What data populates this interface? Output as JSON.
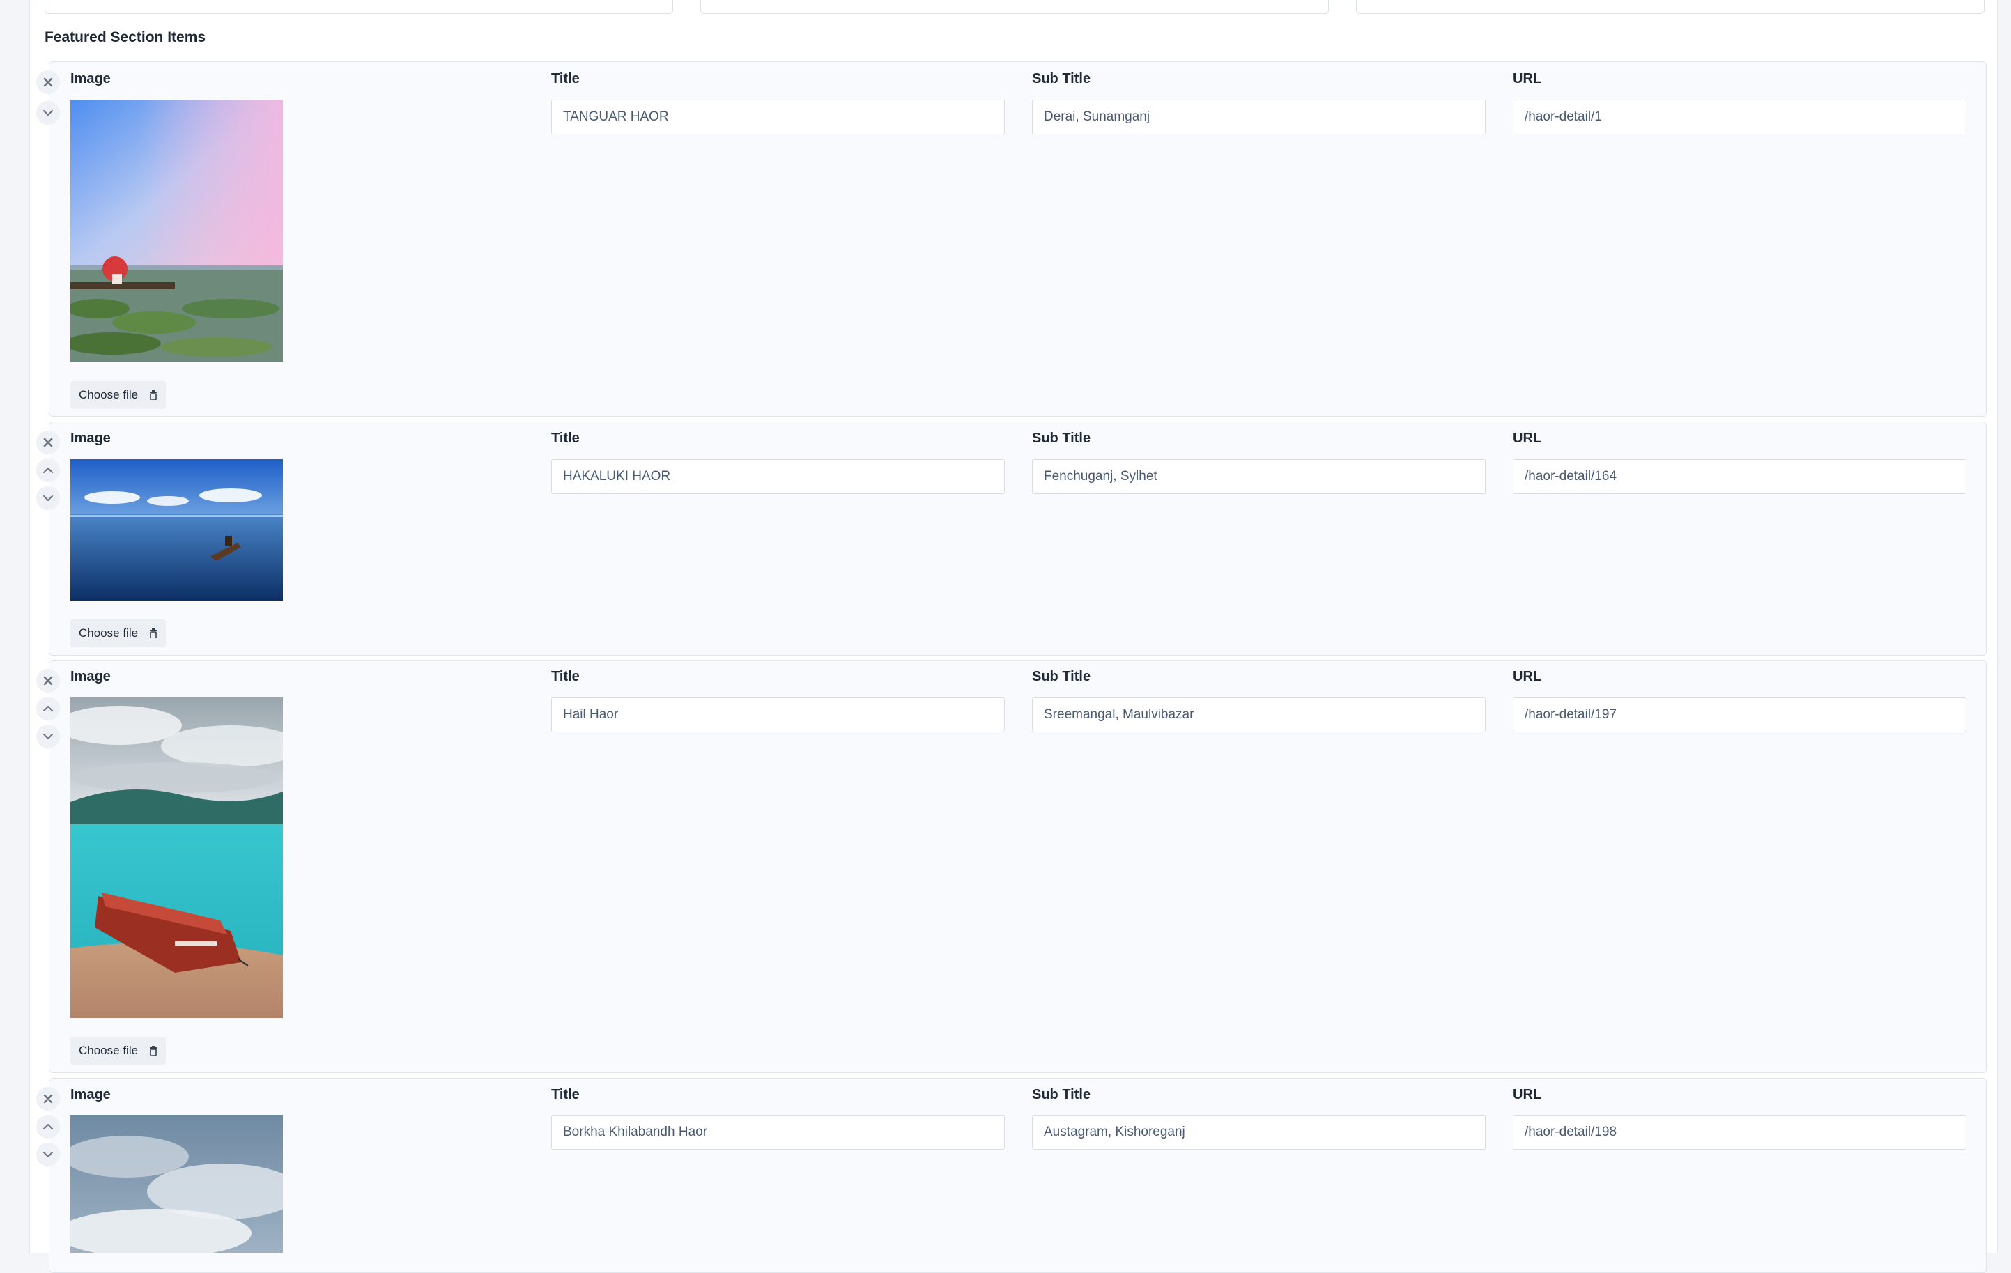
{
  "section_title": "Featured Section Items",
  "labels": {
    "image": "Image",
    "title": "Title",
    "subtitle": "Sub Title",
    "url": "URL"
  },
  "choose_file_label": "Choose file",
  "icons": {
    "remove": "close-icon",
    "move_up": "chevron-up-icon",
    "move_down": "chevron-down-icon",
    "delete_file": "trash-icon"
  },
  "items": [
    {
      "title": "TANGUAR HAOR",
      "subtitle": "Derai, Sunamganj",
      "url": "/haor-detail/1",
      "image_scene": "pink-sky-lake-red-umbrella-boat"
    },
    {
      "title": "HAKALUKI HAOR",
      "subtitle": "Fenchuganj, Sylhet",
      "url": "/haor-detail/164",
      "image_scene": "blue-lake-boat"
    },
    {
      "title": "Hail Haor",
      "subtitle": "Sreemangal, Maulvibazar",
      "url": "/haor-detail/197",
      "image_scene": "turquoise-lake-red-houseboat"
    },
    {
      "title": "Borkha Khilabandh Haor",
      "subtitle": "Austagram, Kishoreganj",
      "url": "/haor-detail/198",
      "image_scene": "cloudy-sky"
    }
  ]
}
